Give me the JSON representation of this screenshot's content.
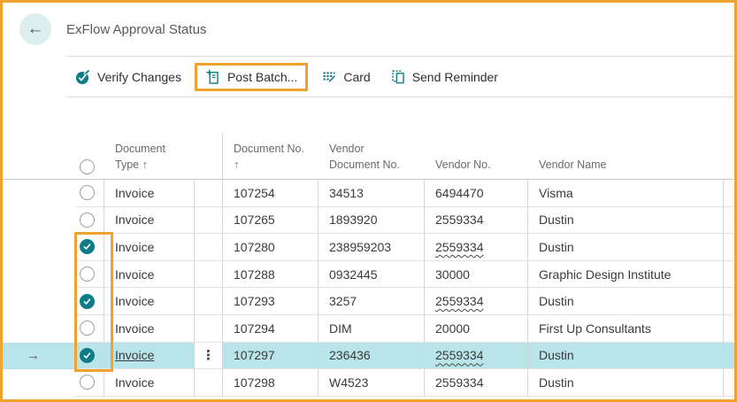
{
  "window": {
    "title": "ExFlow Approval Status"
  },
  "icons": {
    "back": "←",
    "row_selector_arrow": "→",
    "ellipsis": "⋮"
  },
  "toolbar": {
    "items": [
      {
        "label": "Verify Changes",
        "icon": "verify-changes-icon",
        "highlighted": false
      },
      {
        "label": "Post Batch...",
        "icon": "post-batch-icon",
        "highlighted": true
      },
      {
        "label": "Card",
        "icon": "card-icon",
        "highlighted": false
      },
      {
        "label": "Send Reminder",
        "icon": "send-reminder-icon",
        "highlighted": false
      }
    ]
  },
  "table": {
    "columns": [
      {
        "line1": "Document",
        "line2": "Type ↑"
      },
      {
        "line1": "Document No.",
        "line2": "↑"
      },
      {
        "line1": "Vendor",
        "line2": "Document No."
      },
      {
        "line1": "Vendor No.",
        "line2": ""
      },
      {
        "line1": "Vendor Name",
        "line2": ""
      }
    ],
    "rows": [
      {
        "doc_type": "Invoice",
        "doc_no": "107254",
        "vendor_doc_no": "34513",
        "vendor_no": "6494470",
        "vendor_name": "Visma",
        "checked": false,
        "selected": false,
        "vendor_no_wavy": false
      },
      {
        "doc_type": "Invoice",
        "doc_no": "107265",
        "vendor_doc_no": "1893920",
        "vendor_no": "2559334",
        "vendor_name": "Dustin",
        "checked": false,
        "selected": false,
        "vendor_no_wavy": false
      },
      {
        "doc_type": "Invoice",
        "doc_no": "107280",
        "vendor_doc_no": "238959203",
        "vendor_no": "2559334",
        "vendor_name": "Dustin",
        "checked": true,
        "selected": false,
        "vendor_no_wavy": true
      },
      {
        "doc_type": "Invoice",
        "doc_no": "107288",
        "vendor_doc_no": "0932445",
        "vendor_no": "30000",
        "vendor_name": "Graphic Design Institute",
        "checked": false,
        "selected": false,
        "vendor_no_wavy": false
      },
      {
        "doc_type": "Invoice",
        "doc_no": "107293",
        "vendor_doc_no": "3257",
        "vendor_no": "2559334",
        "vendor_name": "Dustin",
        "checked": true,
        "selected": false,
        "vendor_no_wavy": true
      },
      {
        "doc_type": "Invoice",
        "doc_no": "107294",
        "vendor_doc_no": "DIM",
        "vendor_no": "20000",
        "vendor_name": "First Up Consultants",
        "checked": false,
        "selected": false,
        "vendor_no_wavy": false
      },
      {
        "doc_type": "Invoice",
        "doc_no": "107297",
        "vendor_doc_no": "236436",
        "vendor_no": "2559334",
        "vendor_name": "Dustin",
        "checked": true,
        "selected": true,
        "vendor_no_wavy": true
      },
      {
        "doc_type": "Invoice",
        "doc_no": "107298",
        "vendor_doc_no": "W4523",
        "vendor_no": "2559334",
        "vendor_name": "Dustin",
        "checked": false,
        "selected": false,
        "vendor_no_wavy": false
      }
    ]
  },
  "colors": {
    "accent_teal": "#0e7c87",
    "highlight_orange": "#efa22f",
    "selected_row_bg": "#b9e5ea",
    "back_circle_bg": "#ddeef0"
  }
}
